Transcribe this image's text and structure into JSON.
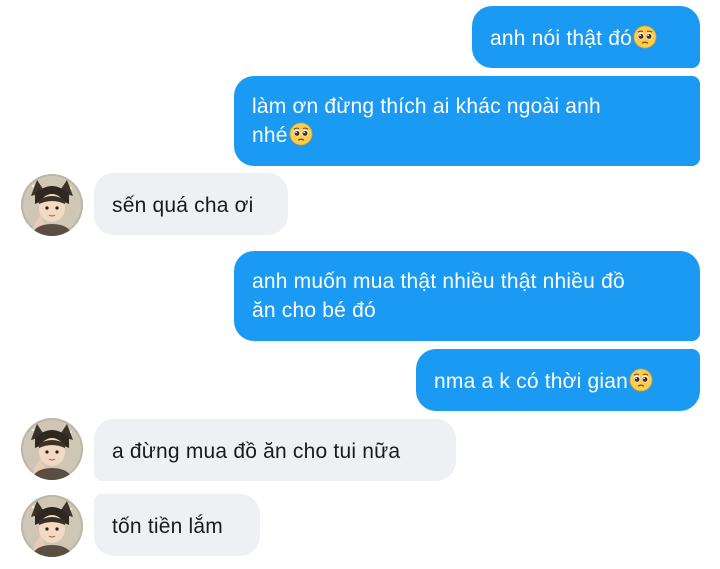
{
  "messages": [
    {
      "sender": "me",
      "text": "anh nói thật đó",
      "emoji": "pleading-face"
    },
    {
      "sender": "me",
      "line1": "làm ơn đừng thích ai khác ngoài anh",
      "line2": "nhé",
      "emoji": "pleading-face"
    },
    {
      "sender": "them",
      "text": "sến quá cha ơi"
    },
    {
      "sender": "me",
      "line1": "anh muốn mua thật nhiều thật nhiều đồ",
      "line2": "ăn cho bé đó"
    },
    {
      "sender": "me",
      "text": "nma a k có thời gian",
      "emoji": "pleading-face"
    },
    {
      "sender": "them",
      "text": "a đừng mua đồ ăn cho tui nữa"
    },
    {
      "sender": "them",
      "text": "tốn tiền lắm"
    }
  ],
  "colors": {
    "outgoing_bubble": "#1a9af2",
    "incoming_bubble": "#eef0f3",
    "outgoing_text": "#ffffff",
    "incoming_text": "#1a1a1a"
  }
}
